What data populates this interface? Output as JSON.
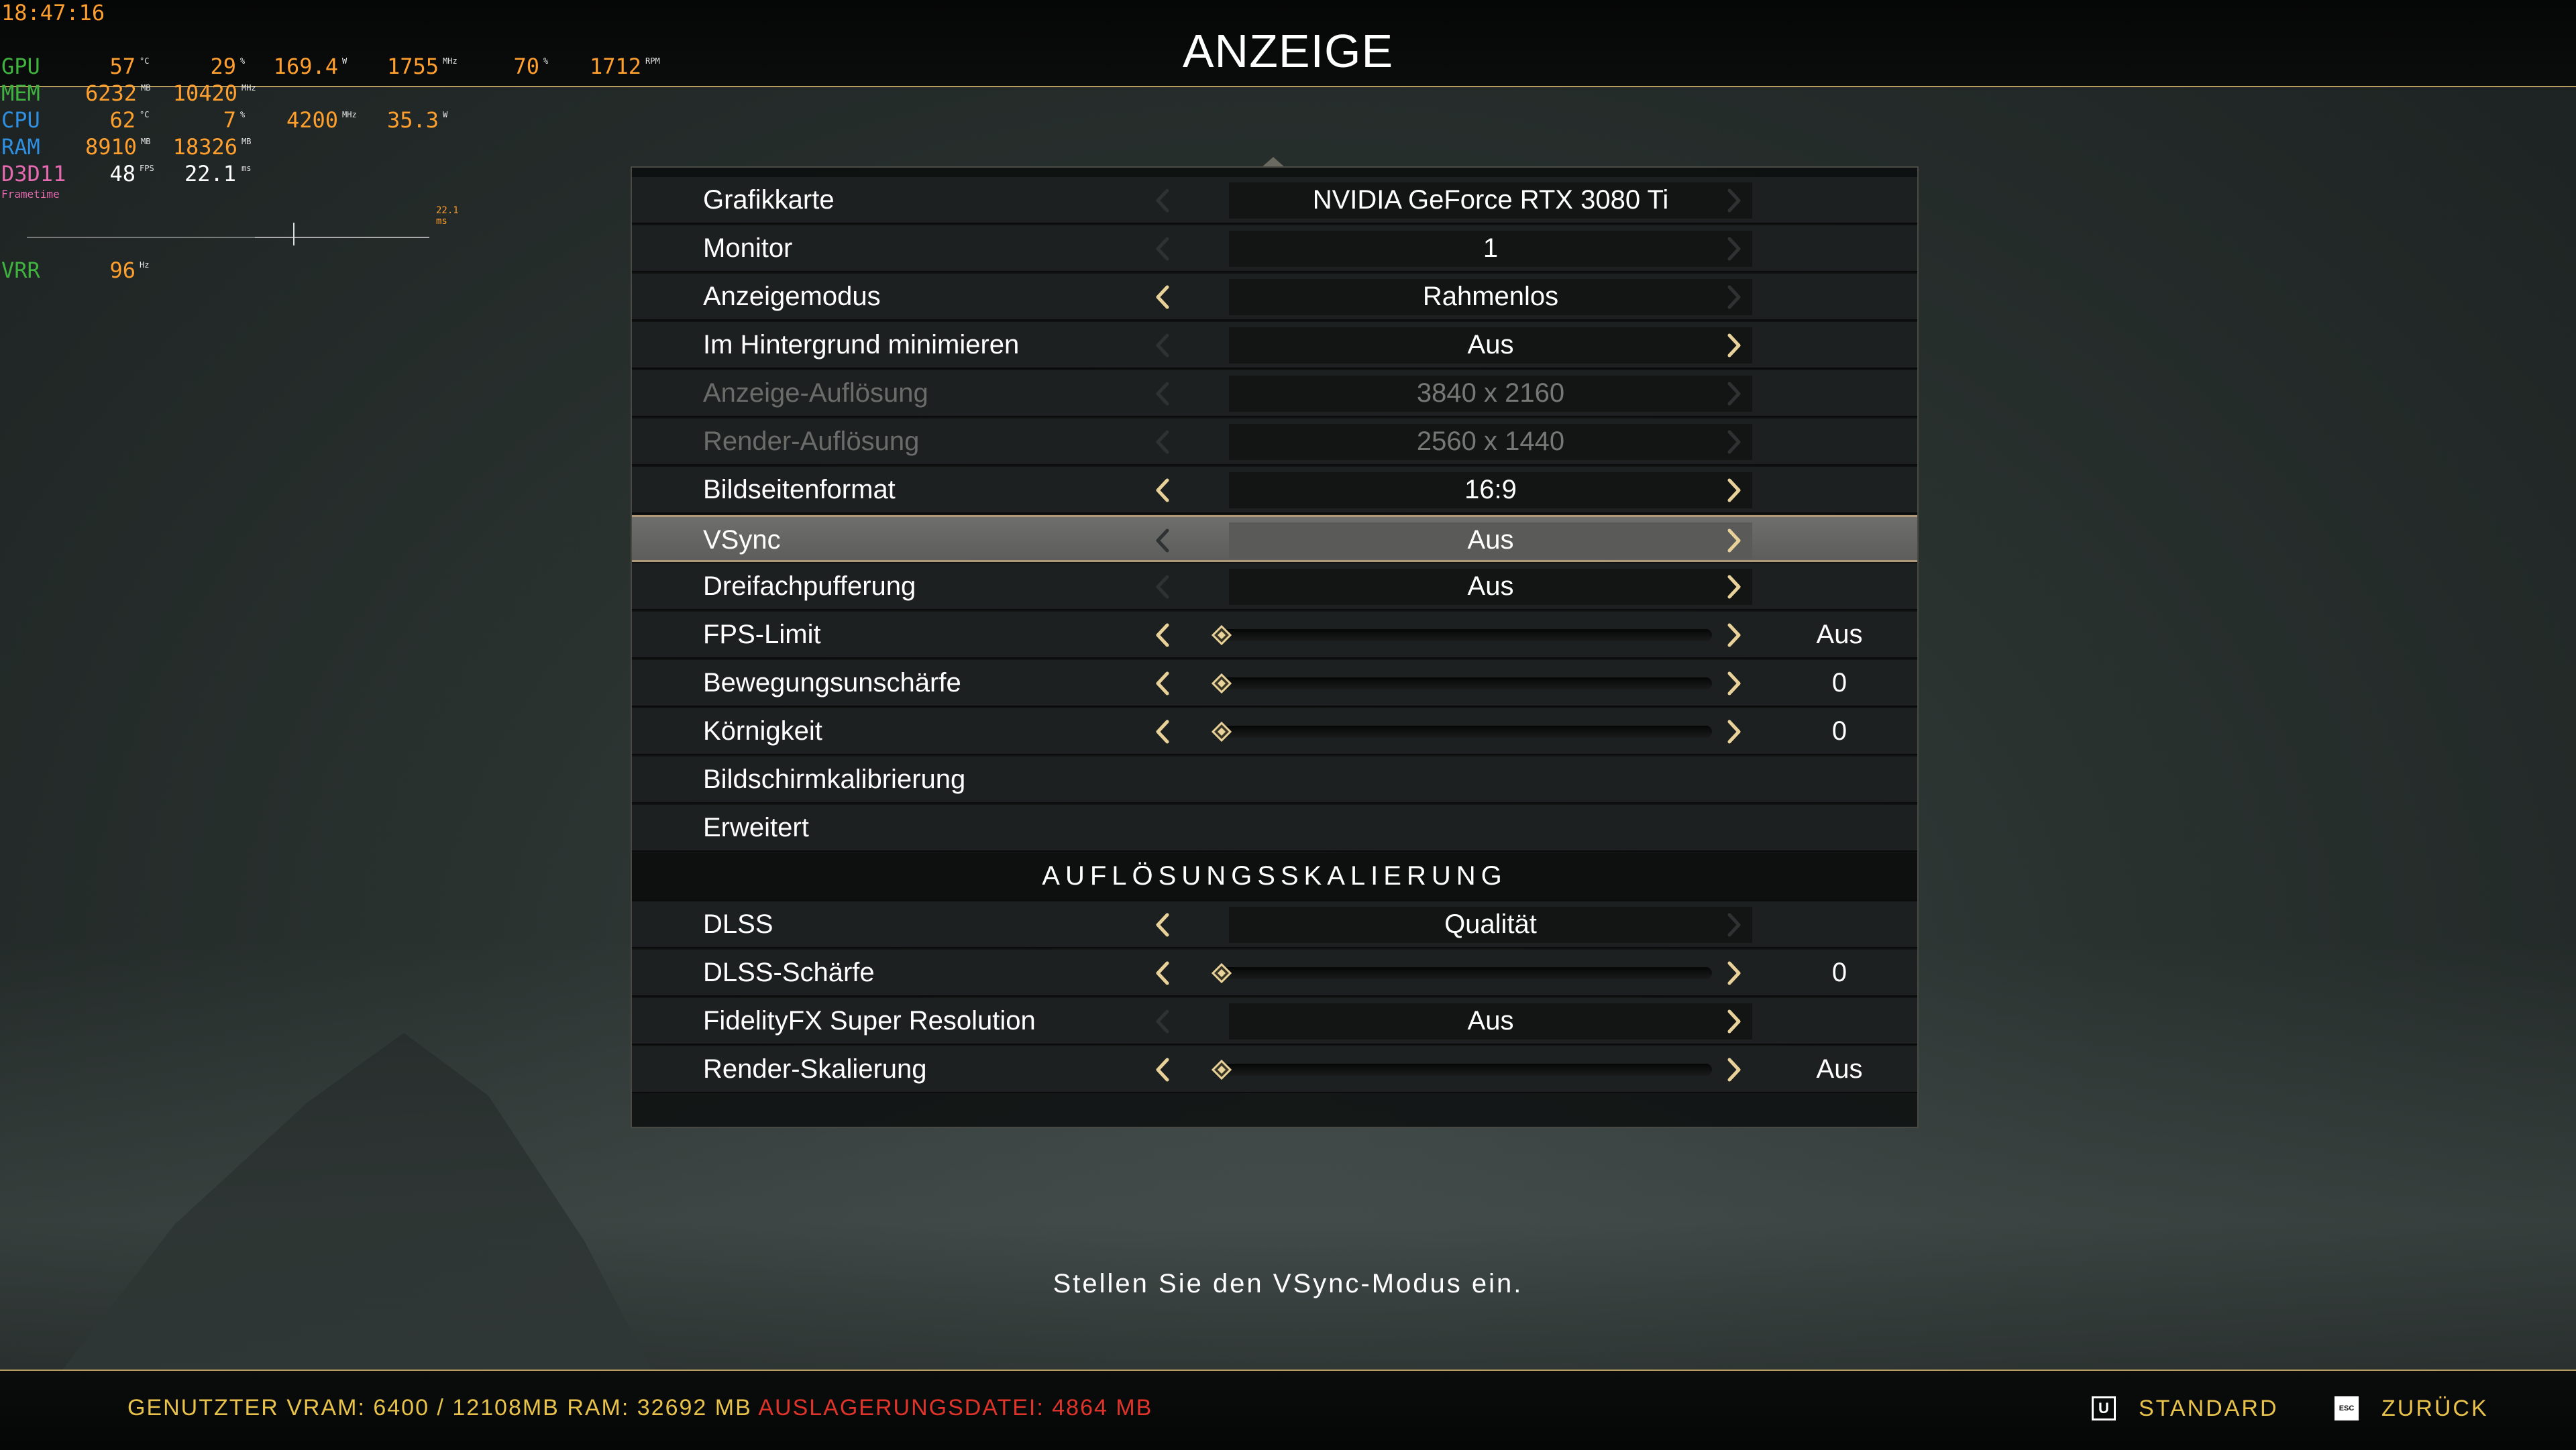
{
  "page": {
    "title": "ANZEIGE",
    "hint": "Stellen Sie den VSync-Modus ein."
  },
  "osd": {
    "time": "18:47:16",
    "gpu": {
      "label": "GPU",
      "temp": "57",
      "temp_unit": "°C",
      "load": "29",
      "load_unit": "%",
      "power": "169.4",
      "power_unit": "W",
      "clock": "1755",
      "clock_unit": "MHz",
      "fan": "70",
      "fan_unit": "%",
      "rpm": "1712",
      "rpm_unit": "RPM"
    },
    "mem": {
      "label": "MEM",
      "used": "6232",
      "used_unit": "MB",
      "clock": "10420",
      "clock_unit": "MHz"
    },
    "cpu": {
      "label": "CPU",
      "temp": "62",
      "temp_unit": "°C",
      "load": "7",
      "load_unit": "%",
      "clock": "4200",
      "clock_unit": "MHz",
      "power": "35.3",
      "power_unit": "W"
    },
    "ram": {
      "label": "RAM",
      "used": "8910",
      "used_unit": "MB",
      "total": "18326",
      "total_unit": "MB"
    },
    "d3d": {
      "label": "D3D11",
      "fps": "48",
      "fps_unit": "FPS",
      "frametime": "22.1",
      "frametime_unit": "ms"
    },
    "frametime_label": "Frametime",
    "graph_label": "22.1 ms",
    "vrr": {
      "label": "VRR",
      "value": "96",
      "unit": "Hz"
    }
  },
  "settings": [
    {
      "label": "Grafikkarte",
      "value": "NVIDIA GeForce RTX 3080 Ti",
      "type": "select",
      "left": "dim",
      "right": "dim"
    },
    {
      "label": "Monitor",
      "value": "1",
      "type": "select",
      "left": "dim",
      "right": "dim"
    },
    {
      "label": "Anzeigemodus",
      "value": "Rahmenlos",
      "type": "select",
      "left": "active",
      "right": "dim"
    },
    {
      "label": "Im Hintergrund minimieren",
      "value": "Aus",
      "type": "select",
      "left": "dim",
      "right": "active"
    },
    {
      "label": "Anzeige-Auflösung",
      "value": "3840 x 2160",
      "type": "select",
      "disabled": true,
      "left": "dim",
      "right": "dim"
    },
    {
      "label": "Render-Auflösung",
      "value": "2560 x 1440",
      "type": "select",
      "disabled": true,
      "left": "dim",
      "right": "dim"
    },
    {
      "label": "Bildseitenformat",
      "value": "16:9",
      "type": "select",
      "left": "active",
      "right": "active"
    },
    {
      "label": "VSync",
      "value": "Aus",
      "type": "select",
      "selected": true,
      "left": "dim",
      "right": "active"
    },
    {
      "label": "Dreifachpufferung",
      "value": "Aus",
      "type": "select",
      "left": "dim",
      "right": "active"
    },
    {
      "label": "FPS-Limit",
      "value": "Aus",
      "type": "slider",
      "level": 0
    },
    {
      "label": "Bewegungsunschärfe",
      "value": "0",
      "type": "slider",
      "level": 0
    },
    {
      "label": "Körnigkeit",
      "value": "0",
      "type": "slider",
      "level": 0
    },
    {
      "label": "Bildschirmkalibrierung",
      "type": "link"
    },
    {
      "label": "Erweitert",
      "type": "link"
    },
    {
      "section": "AUFLÖSUNGSSKALIERUNG"
    },
    {
      "label": "DLSS",
      "value": "Qualität",
      "type": "select",
      "left": "active",
      "right": "dim"
    },
    {
      "label": "DLSS-Schärfe",
      "value": "0",
      "type": "slider",
      "level": 0
    },
    {
      "label": "FidelityFX Super Resolution",
      "value": "Aus",
      "type": "select",
      "left": "dim",
      "right": "active"
    },
    {
      "label": "Render-Skalierung",
      "value": "Aus",
      "type": "slider",
      "level": 0
    }
  ],
  "footer": {
    "vram": "GENUTZTER VRAM: 6400 / 12108MB",
    "ram": "RAM: 32692 MB",
    "pagefile": "AUSLAGERUNGSDATEI: 4864 MB",
    "standard_key": "U",
    "standard_label": "STANDARD",
    "back_key": "ESC",
    "back_label": "ZURÜCK"
  },
  "colors": {
    "accent": "#e8c24a",
    "osd_value": "#ff9f2d",
    "gpu": "#3fb23f",
    "cpu": "#2f8fe0",
    "ram": "#2f8fe0",
    "pagefile": "#e0342a"
  }
}
